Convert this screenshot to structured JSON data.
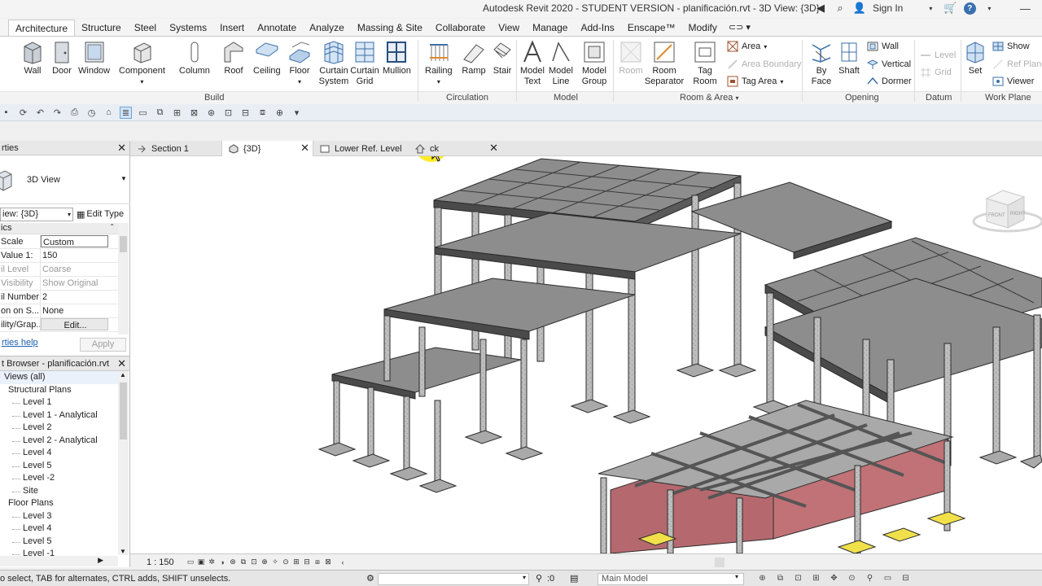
{
  "app": {
    "title": "Autodesk Revit 2020 - STUDENT VERSION - planificación.rvt - 3D View: {3D}",
    "sign_in": "Sign In"
  },
  "ribbon_tabs": [
    "Architecture",
    "Structure",
    "Steel",
    "Systems",
    "Insert",
    "Annotate",
    "Analyze",
    "Massing & Site",
    "Collaborate",
    "View",
    "Manage",
    "Add-Ins",
    "Enscape™",
    "Modify"
  ],
  "ribbon": {
    "tools": [
      {
        "id": "wall",
        "label": "Wall",
        "icon": "wall-icon"
      },
      {
        "id": "door",
        "label": "Door",
        "icon": "door-icon"
      },
      {
        "id": "window",
        "label": "Window",
        "icon": "window-icon"
      },
      {
        "id": "component",
        "label": "Component",
        "icon": "component-icon"
      },
      {
        "id": "column",
        "label": "Column",
        "icon": "column-icon"
      },
      {
        "id": "roof",
        "label": "Roof",
        "icon": "roof-icon"
      },
      {
        "id": "ceiling",
        "label": "Ceiling",
        "icon": "ceiling-icon"
      },
      {
        "id": "floor",
        "label": "Floor",
        "icon": "floor-icon"
      },
      {
        "id": "curtain_system",
        "label": "Curtain\nSystem",
        "icon": "curtain-system-icon"
      },
      {
        "id": "curtain_grid",
        "label": "Curtain\nGrid",
        "icon": "curtain-grid-icon"
      },
      {
        "id": "mullion",
        "label": "Mullion",
        "icon": "mullion-icon"
      },
      {
        "id": "railing",
        "label": "Railing",
        "icon": "railing-icon"
      },
      {
        "id": "ramp",
        "label": "Ramp",
        "icon": "ramp-icon"
      },
      {
        "id": "stair",
        "label": "Stair",
        "icon": "stair-icon"
      },
      {
        "id": "model_text",
        "label": "Model\nText",
        "icon": "model-text-icon"
      },
      {
        "id": "model_line",
        "label": "Model\nLine",
        "icon": "model-line-icon"
      },
      {
        "id": "model_group",
        "label": "Model\nGroup",
        "icon": "model-group-icon"
      },
      {
        "id": "room",
        "label": "Room",
        "icon": "room-icon",
        "dim": true
      },
      {
        "id": "room_separator",
        "label": "Room\nSeparator",
        "icon": "room-separator-icon"
      },
      {
        "id": "tag_room",
        "label": "Tag\nRoom",
        "icon": "tag-room-icon"
      },
      {
        "id": "by_face",
        "label": "By\nFace",
        "icon": "by-face-icon"
      },
      {
        "id": "shaft",
        "label": "Shaft",
        "icon": "shaft-icon"
      },
      {
        "id": "set",
        "label": "Set",
        "icon": "set-icon"
      }
    ],
    "small_tools": {
      "area": "Area",
      "area_boundary": "Area  Boundary",
      "tag_area": "Tag  Area",
      "wall": "Wall",
      "vertical": "Vertical",
      "dormer": "Dormer",
      "level": "Level",
      "grid": "Grid",
      "show": "Show",
      "ref_plane": "Ref  Plane",
      "viewer": "Viewer"
    },
    "panels": [
      "Build",
      "Circulation",
      "Model",
      "Room & Area",
      "Opening",
      "Datum",
      "Work Plane"
    ]
  },
  "properties": {
    "title": "rties",
    "type_label": "3D View",
    "view_selector": "iew: {3D}",
    "edit_type": "Edit Type",
    "section": "ics",
    "rows": [
      {
        "key": "Scale",
        "value": "Custom",
        "style": "boxed"
      },
      {
        "key": "Value  1:",
        "value": "150"
      },
      {
        "key": "il Level",
        "value": "Coarse",
        "dim": true
      },
      {
        "key": "Visibility",
        "value": "Show Original",
        "dim": true
      },
      {
        "key": "il Number",
        "value": "2"
      },
      {
        "key": "on on S...",
        "value": "None"
      },
      {
        "key": "ility/Grap...",
        "value": "Edit...",
        "style": "btn"
      }
    ],
    "help_link": "rties help",
    "apply": "Apply"
  },
  "project_browser": {
    "title": "t Browser - planificación.rvt",
    "items": [
      {
        "label": "Views (all)",
        "level": "root"
      },
      {
        "label": "Structural Plans",
        "level": "cat"
      },
      {
        "label": "Level 1",
        "level": "leaf"
      },
      {
        "label": "Level 1 - Analytical",
        "level": "leaf"
      },
      {
        "label": "Level 2",
        "level": "leaf"
      },
      {
        "label": "Level 2 - Analytical",
        "level": "leaf"
      },
      {
        "label": "Level 4",
        "level": "leaf"
      },
      {
        "label": "Level 5",
        "level": "leaf"
      },
      {
        "label": "Level -2",
        "level": "leaf"
      },
      {
        "label": "Site",
        "level": "leaf"
      },
      {
        "label": "Floor Plans",
        "level": "cat"
      },
      {
        "label": "Level 3",
        "level": "leaf"
      },
      {
        "label": "Level 4",
        "level": "leaf"
      },
      {
        "label": "Level 5",
        "level": "leaf"
      },
      {
        "label": "Level -1",
        "level": "leaf"
      }
    ]
  },
  "view_tabs": [
    {
      "label": "Section 1",
      "icon": "section-view-icon"
    },
    {
      "label": "{3D}",
      "icon": "3d-view-icon",
      "active": true
    },
    {
      "label": "Lower Ref. Level",
      "icon": "plan-view-icon"
    },
    {
      "label": "ck",
      "icon": "home-icon"
    }
  ],
  "viewcube": {
    "front": "FRONT",
    "right": "RIGHT"
  },
  "view_control": {
    "scale": "1 : 150"
  },
  "status": {
    "message": "o select, TAB for alternates, CTRL adds, SHIFT unselects.",
    "zero": ":0",
    "model": "Main Model"
  }
}
